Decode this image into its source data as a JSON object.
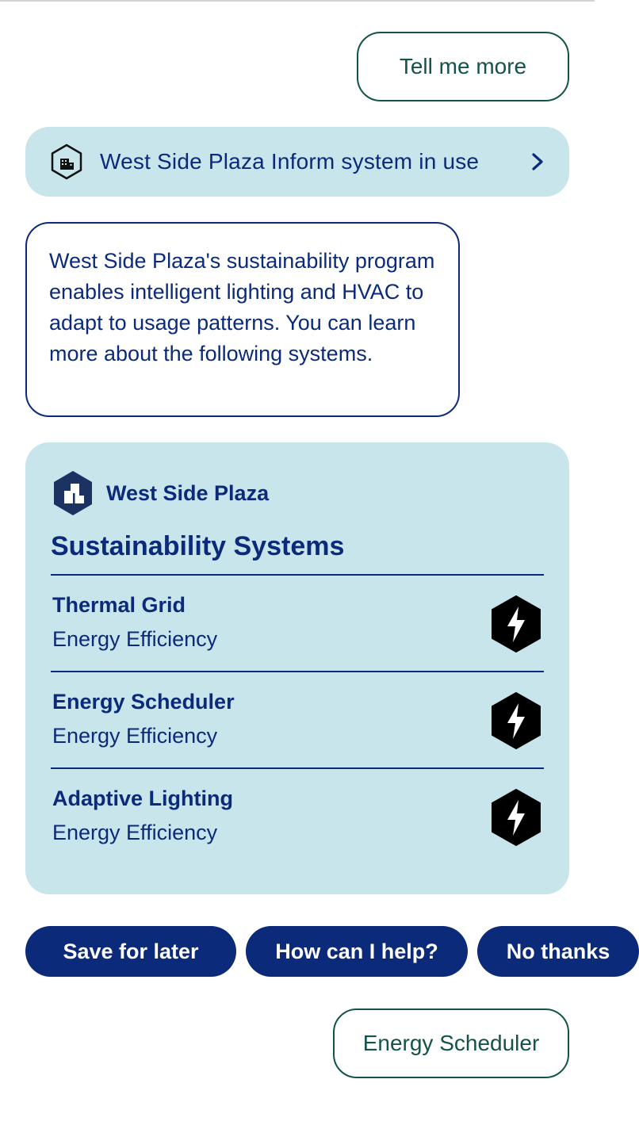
{
  "user_messages": {
    "tell_more": "Tell me more",
    "energy_scheduler": "Energy Scheduler"
  },
  "info_pill": {
    "label": "West Side Plaza Inform system in use",
    "icon": "building-icon",
    "chevron": "chevron-right-icon"
  },
  "bot_message": {
    "text": "West Side Plaza's sustainability program enables intelligent lighting and HVAC to adapt to usage patterns. You can learn more about the following systems."
  },
  "card": {
    "brand": "West Side Plaza",
    "title": "Sustainability Systems",
    "systems": [
      {
        "name": "Thermal Grid",
        "category": "Energy Efficiency",
        "icon": "lightning-bolt-icon"
      },
      {
        "name": "Energy Scheduler",
        "category": "Energy Efficiency",
        "icon": "lightning-bolt-icon"
      },
      {
        "name": "Adaptive Lighting",
        "category": "Energy Efficiency",
        "icon": "lightning-bolt-icon"
      }
    ]
  },
  "quick_replies": {
    "save": "Save for later",
    "help": "How can I help?",
    "no": "No thanks"
  },
  "colors": {
    "navy": "#0b2a7a",
    "teal": "#13534a",
    "light_blue": "#c8e5ec"
  }
}
